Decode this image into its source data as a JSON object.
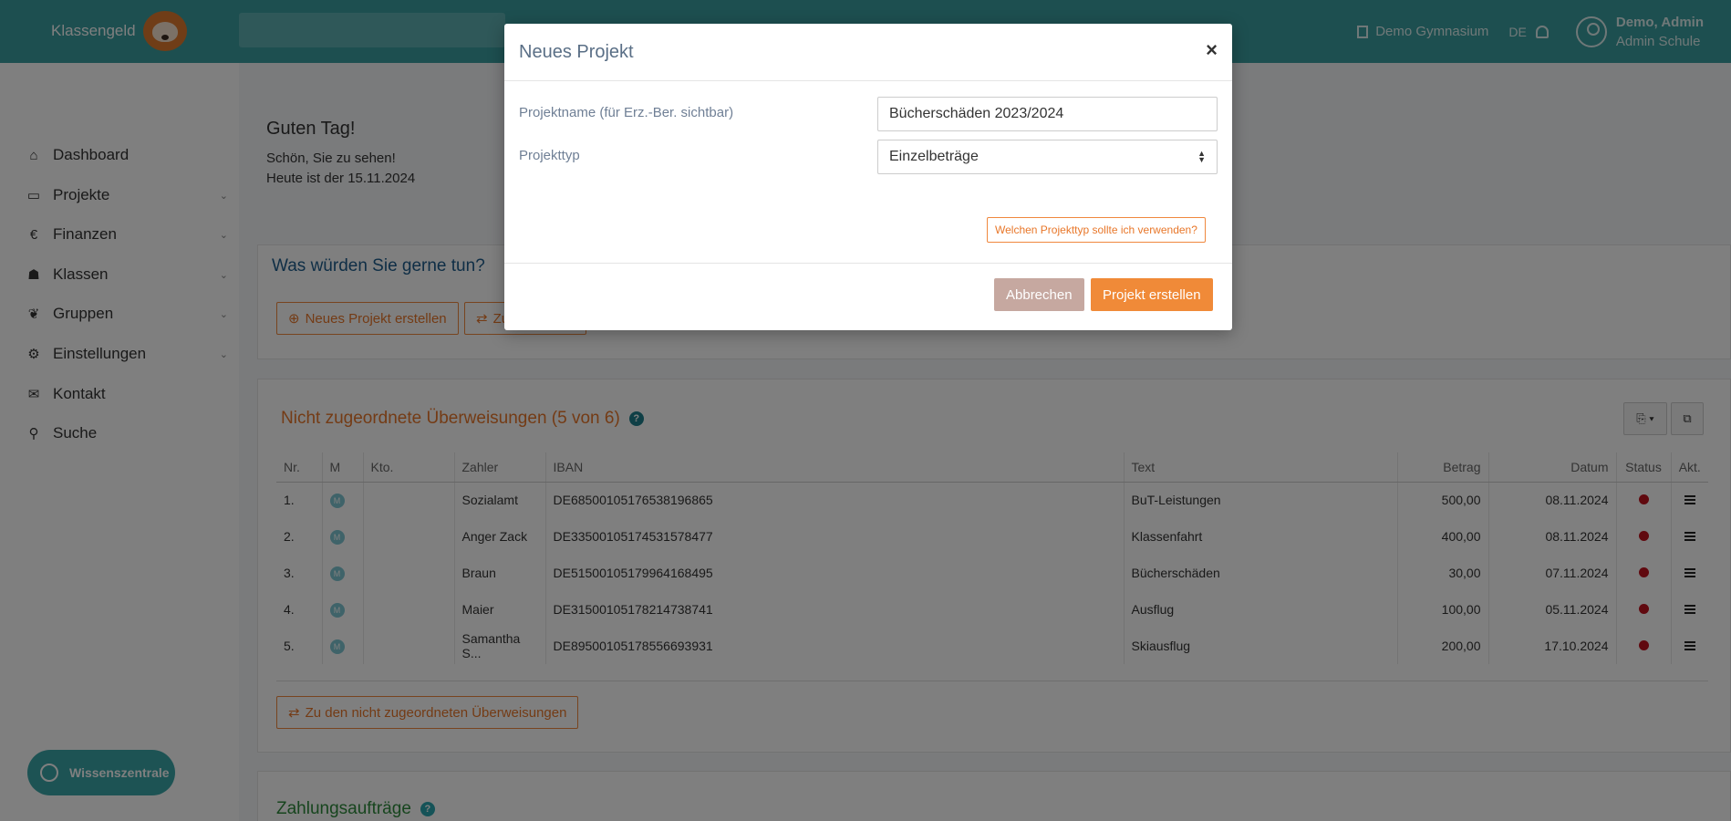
{
  "brand": {
    "name": "Klassengeld"
  },
  "header": {
    "school": "Demo Gymnasium",
    "language": "DE",
    "user_name": "Demo, Admin",
    "user_role": "Admin Schule"
  },
  "sidebar": {
    "items": [
      {
        "label": "Dashboard",
        "icon": "home-icon"
      },
      {
        "label": "Projekte",
        "icon": "card-icon"
      },
      {
        "label": "Finanzen",
        "icon": "euro-icon"
      },
      {
        "label": "Klassen",
        "icon": "users-icon"
      },
      {
        "label": "Gruppen",
        "icon": "leaf-icon"
      },
      {
        "label": "Einstellungen",
        "icon": "gear-icon"
      },
      {
        "label": "Kontakt",
        "icon": "mail-icon"
      },
      {
        "label": "Suche",
        "icon": "search-icon"
      }
    ],
    "help_label": "Wissenszentrale"
  },
  "greeting": {
    "title": "Guten Tag!",
    "line1": "Schön, Sie zu sehen!",
    "line2": "Heute ist der 15.11.2024"
  },
  "actions_panel": {
    "title": "Was würden Sie gerne tun?",
    "new_project": "Neues Projekt erstellen",
    "second_button": "Zu"
  },
  "transactions": {
    "title": "Nicht zugeordnete Überweisungen (5 von 6)",
    "columns": [
      "Nr.",
      "M",
      "Kto.",
      "Zahler",
      "IBAN",
      "Text",
      "Betrag",
      "Datum",
      "Status",
      "Akt."
    ],
    "rows": [
      {
        "nr": "1.",
        "m": "M",
        "kto": "",
        "zahler": "Sozialamt",
        "iban": "DE68500105176538196865",
        "text": "BuT-Leistungen",
        "betrag": "500,00",
        "datum": "08.11.2024"
      },
      {
        "nr": "2.",
        "m": "M",
        "kto": "",
        "zahler": "Anger Zack",
        "iban": "DE33500105174531578477",
        "text": "Klassenfahrt",
        "betrag": "400,00",
        "datum": "08.11.2024"
      },
      {
        "nr": "3.",
        "m": "M",
        "kto": "",
        "zahler": "Braun",
        "iban": "DE51500105179964168495",
        "text": "Bücherschäden",
        "betrag": "30,00",
        "datum": "07.11.2024"
      },
      {
        "nr": "4.",
        "m": "M",
        "kto": "",
        "zahler": "Maier",
        "iban": "DE31500105178214738741",
        "text": "Ausflug",
        "betrag": "100,00",
        "datum": "05.11.2024"
      },
      {
        "nr": "5.",
        "m": "M",
        "kto": "",
        "zahler": "Samantha S...",
        "iban": "DE89500105178556693931",
        "text": "Skiausflug",
        "betrag": "200,00",
        "datum": "17.10.2024"
      }
    ],
    "status_color": "#c0121e",
    "goto_button": "Zu den nicht zugeordneten Überweisungen"
  },
  "payments_panel": {
    "title": "Zahlungsaufträge"
  },
  "modal": {
    "title": "Neues Projekt",
    "name_label": "Projektname (für Erz.-Ber. sichtbar)",
    "name_value": "Bücherschäden 2023/2024",
    "type_label": "Projekttyp",
    "type_value": "Einzelbeträge",
    "hint_button": "Welchen Projekttyp sollte ich verwenden?",
    "cancel_button": "Abbrechen",
    "create_button": "Projekt erstellen"
  },
  "colors": {
    "header_bg": "#3b9fa0",
    "accent_orange": "#f08a38",
    "cancel_bg": "#c6a8a0"
  }
}
